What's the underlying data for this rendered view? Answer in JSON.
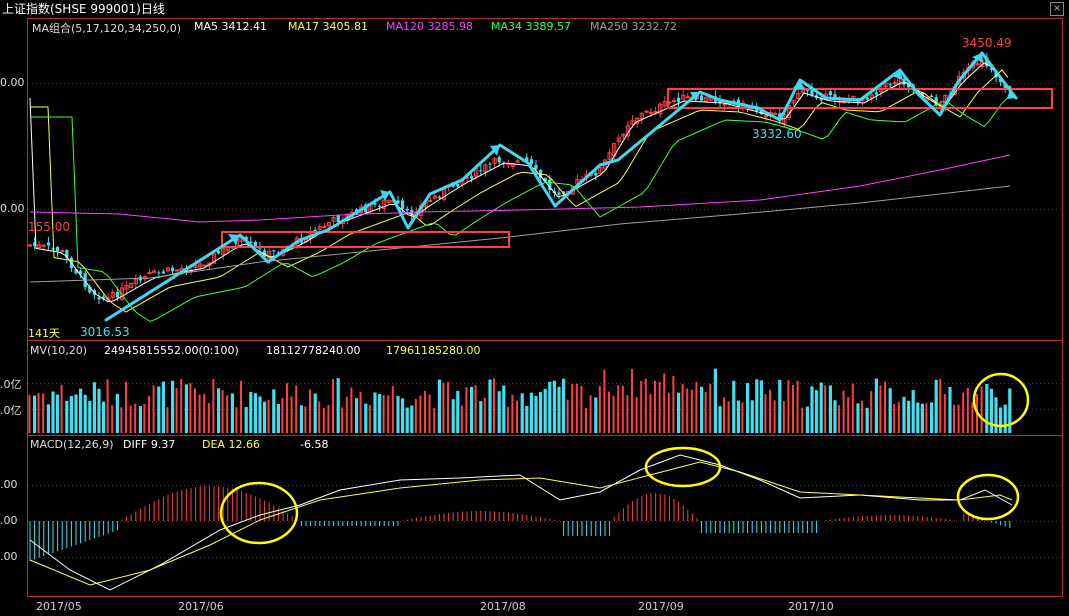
{
  "window": {
    "title": "上证指数(SHSE 999001)日线",
    "close_glyph": "×"
  },
  "colors": {
    "up": "#ff4040",
    "down": "#40e0f0",
    "ma5": "#ffffff",
    "ma17": "#ffff40",
    "ma120": "#ff40ff",
    "ma34": "#40ff40",
    "ma250": "#a0a0a0",
    "annotation_box": "#ff4040",
    "annotation_circle": "#ffff00",
    "annotation_arrow": "#40d8f0"
  },
  "main_panel": {
    "ma_header": {
      "label": "MA组合(5,17,120,34,250,0)",
      "items": [
        {
          "name": "MA5",
          "value": "3412.41",
          "key": "ma5"
        },
        {
          "name": "MA17",
          "value": "3405.81",
          "key": "ma17"
        },
        {
          "name": "MA120",
          "value": "3285.98",
          "key": "ma120"
        },
        {
          "name": "MA34",
          "value": "3389.57",
          "key": "ma34"
        },
        {
          "name": "MA250",
          "value": "3232.72",
          "key": "ma250"
        }
      ]
    },
    "y_labels": [
      "0.00",
      "0.00"
    ],
    "annotations": {
      "high": "3450.49",
      "low": "3016.53",
      "left_price": "155.00",
      "mid_low": "3332.60",
      "days": "141天"
    }
  },
  "volume_panel": {
    "header": {
      "label": "MV(10,20)",
      "v1": "24945815552.00(0:100)",
      "v2": "18112778240.00",
      "v3": "17961185280.00"
    },
    "y_labels": [
      ".0亿",
      ".0亿"
    ]
  },
  "macd_panel": {
    "header": {
      "label": "MACD(12,26,9)",
      "diff_label": "DIFF",
      "diff": "9.37",
      "dea_label": "DEA",
      "dea": "12.66",
      "macd": "-6.58"
    },
    "y_labels": [
      ".00",
      ".00",
      ".00"
    ]
  },
  "x_axis": [
    "2017/05",
    "2017/06",
    "2017/08",
    "2017/09",
    "2017/10"
  ]
}
